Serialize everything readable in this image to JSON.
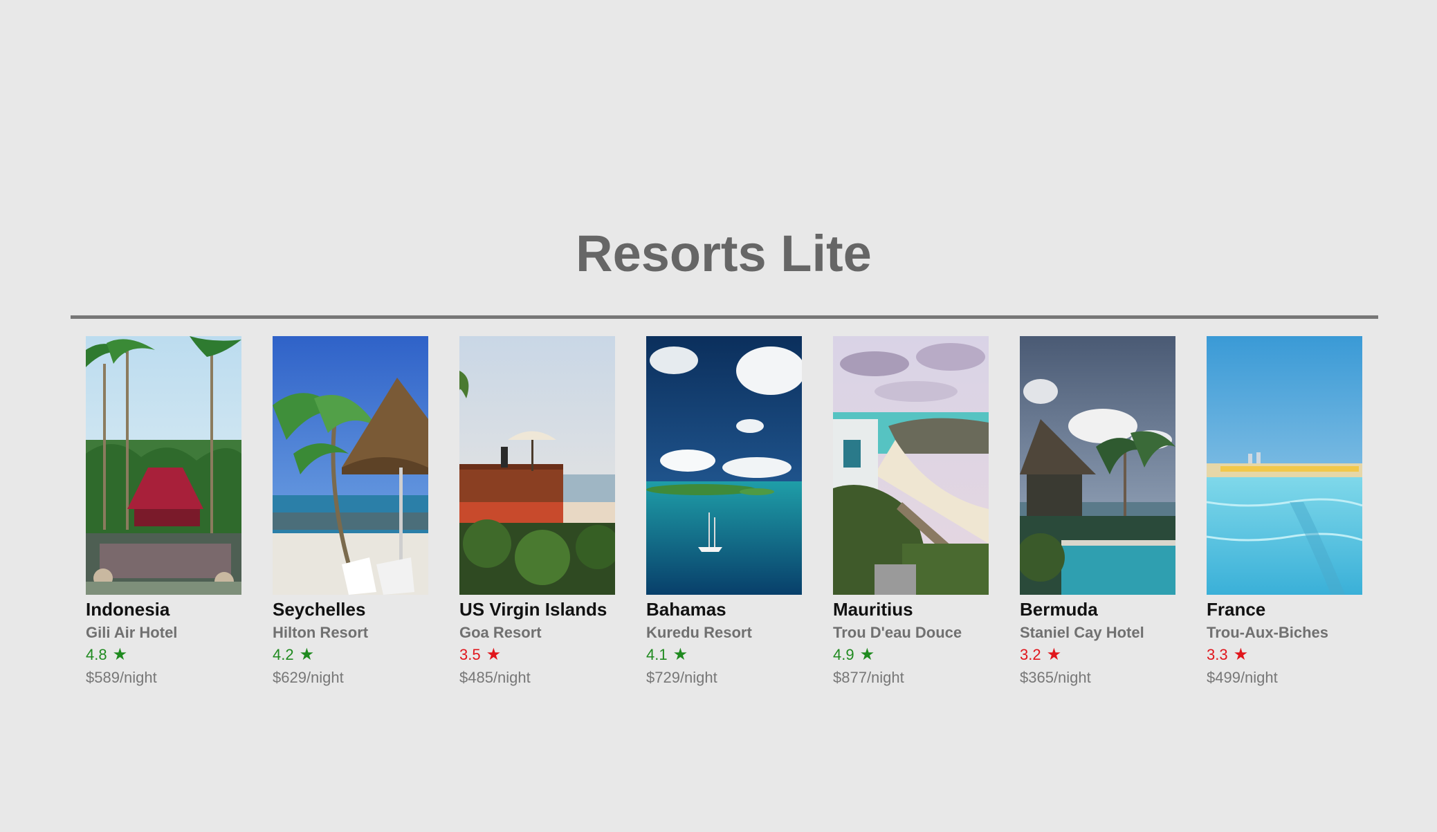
{
  "app": {
    "title": "Resorts Lite"
  },
  "colors": {
    "rating_high": "#1f8a1f",
    "rating_low": "#e0161c"
  },
  "resorts": [
    {
      "country": "Indonesia",
      "hotel": "Gili Air Hotel",
      "rating": "4.8",
      "star": "★",
      "rating_level": "high",
      "price": "$589/night",
      "photo_icon": "tropical-villa-pool-photo"
    },
    {
      "country": "Seychelles",
      "hotel": "Hilton Resort",
      "rating": "4.2",
      "star": "★",
      "rating_level": "high",
      "price": "$629/night",
      "photo_icon": "beach-umbrella-palm-photo"
    },
    {
      "country": "US Virgin Islands",
      "hotel": "Goa Resort",
      "rating": "3.5",
      "star": "★",
      "rating_level": "low",
      "price": "$485/night",
      "photo_icon": "balcony-sea-view-photo"
    },
    {
      "country": "Bahamas",
      "hotel": "Kuredu Resort",
      "rating": "4.1",
      "star": "★",
      "rating_level": "high",
      "price": "$729/night",
      "photo_icon": "ocean-sailboat-photo"
    },
    {
      "country": "Mauritius",
      "hotel": "Trou D'eau Douce",
      "rating": "4.9",
      "star": "★",
      "rating_level": "high",
      "price": "$877/night",
      "photo_icon": "coastal-cliff-photo"
    },
    {
      "country": "Bermuda",
      "hotel": "Staniel Cay Hotel",
      "rating": "3.2",
      "star": "★",
      "rating_level": "low",
      "price": "$365/night",
      "photo_icon": "thatched-hut-pool-photo"
    },
    {
      "country": "France",
      "hotel": "Trou-Aux-Biches",
      "rating": "3.3",
      "star": "★",
      "rating_level": "low",
      "price": "$499/night",
      "photo_icon": "swimming-pool-photo"
    }
  ]
}
